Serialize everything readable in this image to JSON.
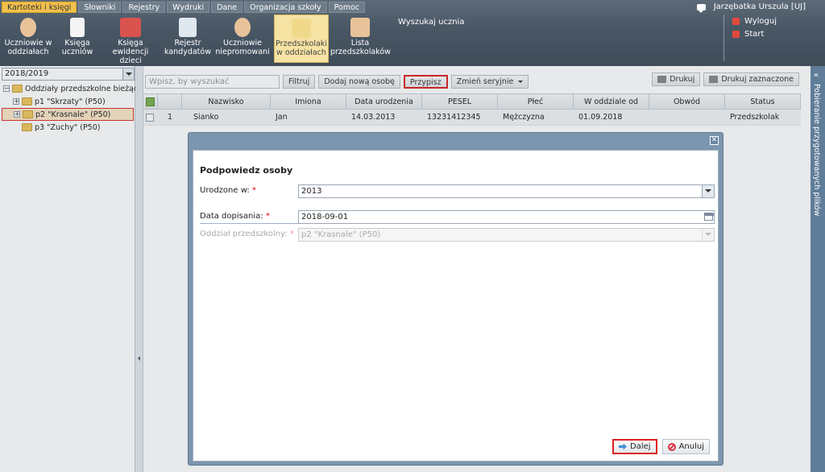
{
  "menu": {
    "tabs": [
      "Kartoteki i księgi",
      "Słowniki",
      "Rejestry",
      "Wydruki",
      "Dane",
      "Organizacja szkoły",
      "Pomoc"
    ],
    "active_tab": "Kartoteki i księgi"
  },
  "user": {
    "name": "Jarzębatka Urszula [UJ]"
  },
  "toolbar": {
    "buttons": [
      {
        "line1": "Uczniowie w",
        "line2": "oddziałach",
        "icon": "students-icon"
      },
      {
        "line1": "Księga",
        "line2": "uczniów",
        "icon": "book-icon"
      },
      {
        "line1": "Księga",
        "line2": "ewidencji dzieci",
        "icon": "ledger-icon"
      },
      {
        "line1": "Rejestr",
        "line2": "kandydatów",
        "icon": "register-icon"
      },
      {
        "line1": "Uczniowie",
        "line2": "niepromowani",
        "icon": "nonpromoted-icon"
      },
      {
        "line1": "Przedszkolaki",
        "line2": "w oddziałach",
        "icon": "preschool-icon"
      },
      {
        "line1": "Lista",
        "line2": "przedszkolaków",
        "icon": "list-icon"
      }
    ],
    "active_index": 5,
    "search_label": "Wyszukaj ucznia"
  },
  "right_links": {
    "logout": "Wyloguj",
    "start": "Start"
  },
  "left": {
    "year": "2018/2019",
    "tree_root": "Oddziały przedszkolne bieżące",
    "groups": [
      "p1 \"Skrzaty\" (P50)",
      "p2 \"Krasnale\" (P50)",
      "p3 \"Zuchy\" (P50)"
    ],
    "selected_index": 1
  },
  "actions": {
    "search_placeholder": "Wpisz, by wyszukać",
    "filter": "Filtruj",
    "add_person": "Dodaj nową osobę",
    "assign": "Przypisz",
    "change_serial": "Zmień seryjnie",
    "print": "Drukuj",
    "print_selected": "Drukuj zaznaczone"
  },
  "grid": {
    "columns": [
      "Nazwisko",
      "Imiona",
      "Data urodzenia",
      "PESEL",
      "Płeć",
      "W oddziale od",
      "Obwód",
      "Status"
    ],
    "rows": [
      {
        "num": "1",
        "surname": "Sianko",
        "names": "Jan",
        "birth": "14.03.2013",
        "pesel": "13231412345",
        "sex": "Mężczyzna",
        "since": "01.09.2018",
        "district": "",
        "status": "Przedszkolak"
      }
    ]
  },
  "sidepanel": {
    "label": "Pobieranie przygotowanych plików"
  },
  "dialog": {
    "title": "Podpowiedz osoby",
    "born_label": "Urodzone w:",
    "born_value": "2013",
    "date_label": "Data dopisania:",
    "date_value": "2018-09-01",
    "unit_label": "Oddział przedszkolny:",
    "unit_value": "p2 \"Krasnale\" (P50)",
    "required_mark": "*",
    "next": "Dalej",
    "cancel": "Anuluj"
  }
}
